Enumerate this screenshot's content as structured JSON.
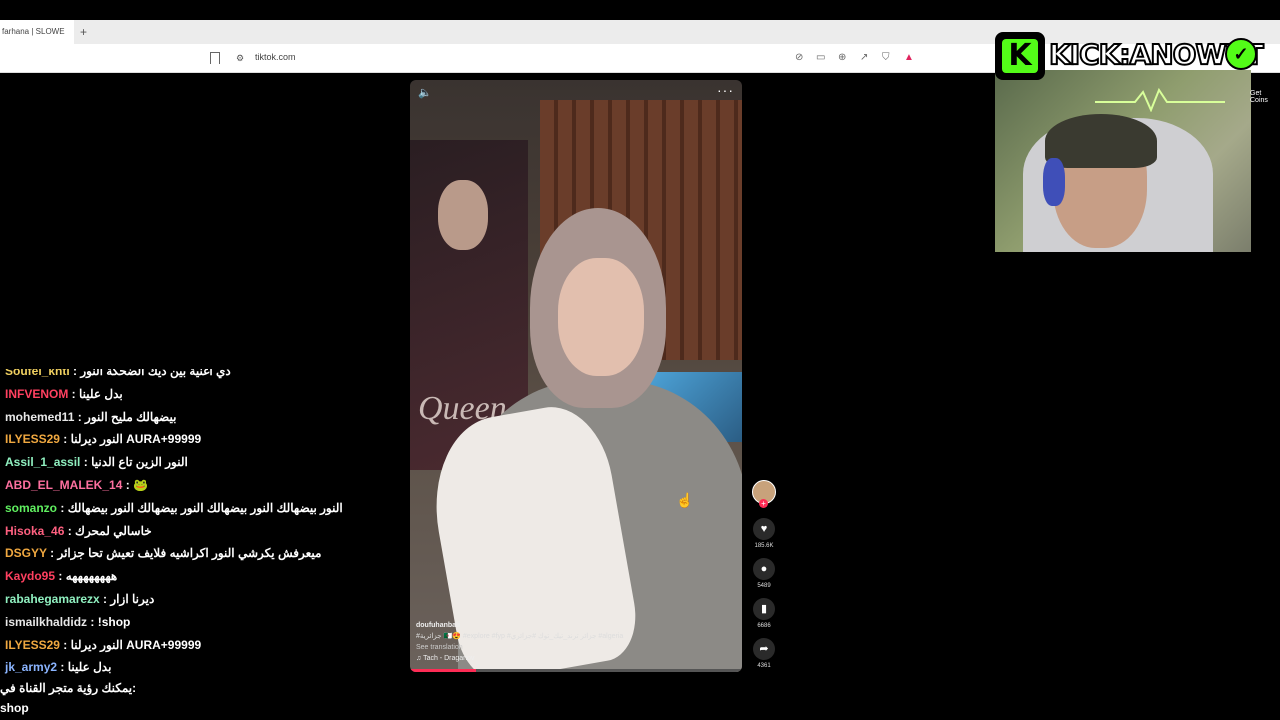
{
  "browser": {
    "tab_title": "farhana | SLOWE",
    "tab_add": "+",
    "url": "tiktok.com"
  },
  "video": {
    "poster_text": "Queen",
    "username": "doufuhanbali",
    "hashtags": "#جزائرية 🇩🇿😍 #explore #fyp #جزائر ترند_تيك_توك #جزائري #algeria",
    "see_translation": "See translation",
    "sound": "♫ Tach - Draganov",
    "progress_fraction": 0.2
  },
  "actions": {
    "likes": "185.6K",
    "comments": "5489",
    "saves": "6686",
    "shares": "4361"
  },
  "streamer": {
    "brand_text": "KICK:ANOWYT",
    "get_coins": "Get Coins"
  },
  "chat": {
    "messages": [
      {
        "user": "Soufel_khti",
        "color": "#f0d060",
        "text": "ذي اغنية بين ديك الضحكة النور"
      },
      {
        "user": "INFVENOM",
        "color": "#ff4060",
        "text": "بدل علينا"
      },
      {
        "user": "mohemed11",
        "color": "#e8e8e8",
        "text": "بيضهالك مليح النور"
      },
      {
        "user": "ILYESS29",
        "color": "#f0a840",
        "text": "النور ديرلنا AURA+99999"
      },
      {
        "user": "Assil_1_assil",
        "color": "#90f0c0",
        "text": "النور الزين تاع الدنيا"
      },
      {
        "user": "ABD_EL_MALEK_14",
        "color": "#ff70a0",
        "text": "🐸"
      },
      {
        "user": "somanzo",
        "color": "#60f060",
        "text": "النور بيضهالك النور بيضهالك النور بيضهالك النور بيضهالك"
      },
      {
        "user": "Hisoka_46",
        "color": "#ff6080",
        "text": "خاسالي لمحرك"
      },
      {
        "user": "DSGYY",
        "color": "#f0a840",
        "text": "ميعرفش يكرشي النور اكراشيه فلايف تعيش تحا جزائر"
      },
      {
        "user": "Kaydo95",
        "color": "#ff4060",
        "text": "ههههههههه"
      },
      {
        "user": "rabahegamarezx",
        "color": "#90f0c0",
        "text": "ديرنا ازار"
      },
      {
        "user": "ismailkhaldidz",
        "color": "#e8e8e8",
        "text": "!shop"
      },
      {
        "user": "ILYESS29",
        "color": "#f0a840",
        "text": "النور ديرلنا AURA+99999"
      },
      {
        "user": "jk_army2",
        "color": "#8ab4ff",
        "text": "بدل علينا"
      }
    ],
    "footer_line1": "يمكنك رؤية متجر القناة في:",
    "footer_line2": "shop"
  }
}
